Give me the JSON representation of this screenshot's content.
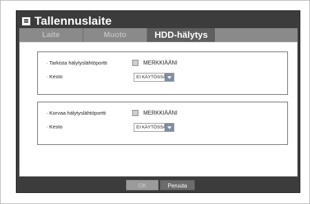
{
  "window": {
    "title": "Tallennuslaite",
    "icon": "window-menu-icon"
  },
  "tabs": [
    {
      "label": "Laite",
      "selected": false
    },
    {
      "label": "Muoto",
      "selected": false
    },
    {
      "label": "HDD-hälytys",
      "selected": true
    }
  ],
  "groups": [
    {
      "alarm_label": "· Tarkista hälytyslähtöportti",
      "checkbox_label": "MERKKIÄÄNI",
      "checkbox_checked": false,
      "duration_label": "· Kesto",
      "duration_value": "EI KÄYTÖSSÄ"
    },
    {
      "alarm_label": "· Korvaa hälytyslähtöportti",
      "checkbox_label": "MERKKIÄÄNI",
      "checkbox_checked": false,
      "duration_label": "· Kesto",
      "duration_value": "EI KÄYTÖSSÄ"
    }
  ],
  "buttons": {
    "ok_label": "OK",
    "cancel_label": "Peruuta"
  },
  "colors": {
    "frame": "#3c3c3c",
    "tab_selected": "#5f5f5f",
    "tab_unselected": "#8a8a8a",
    "dropdown_arrow": "#7f8fa3"
  }
}
